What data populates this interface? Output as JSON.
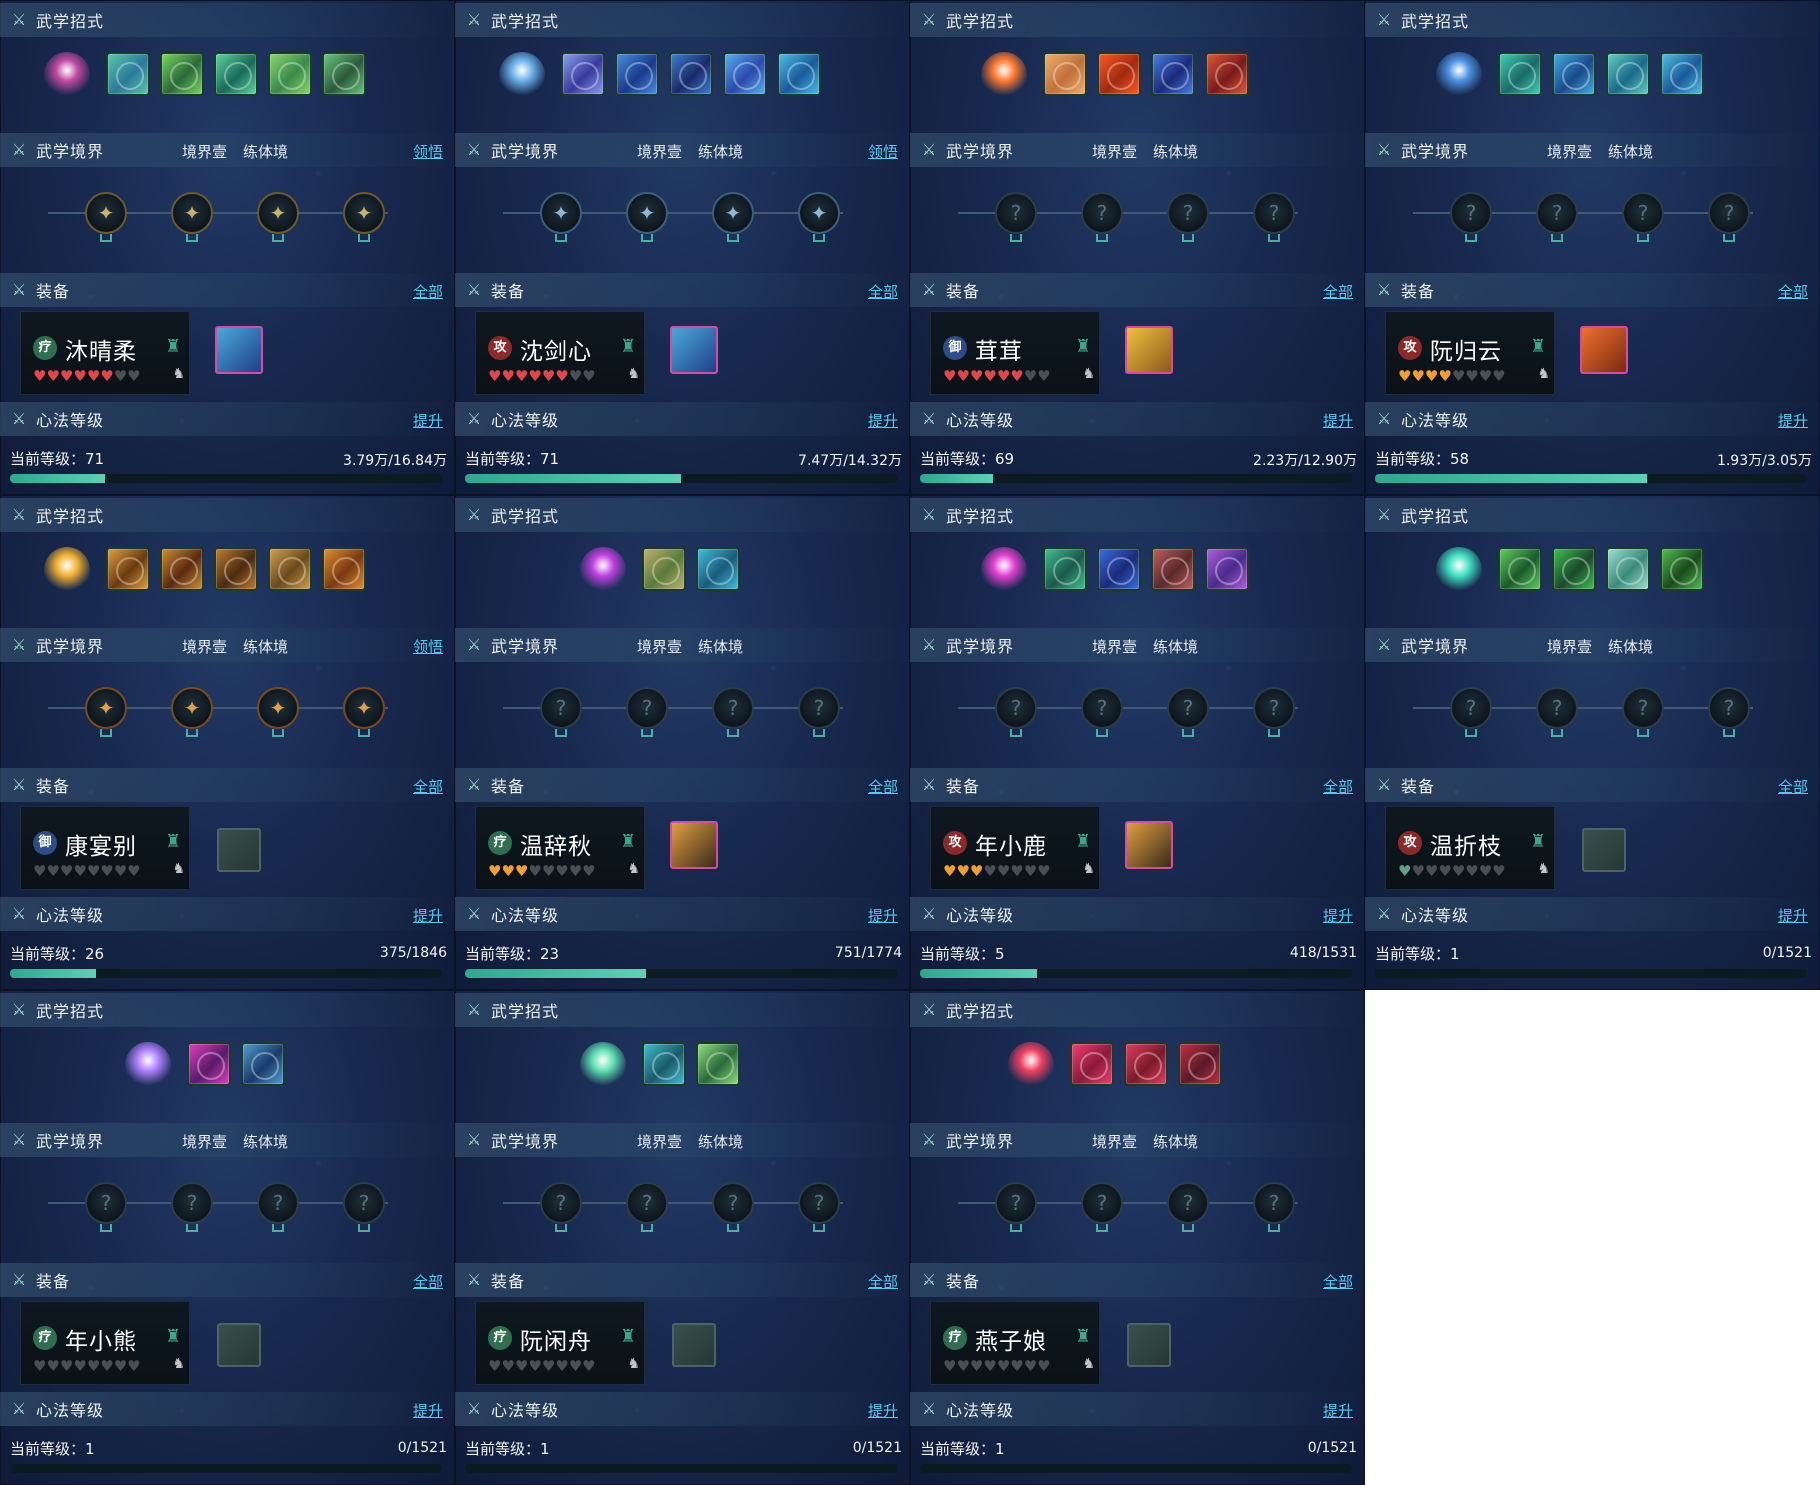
{
  "labels": {
    "skills": "武学招式",
    "realm": "武学境界",
    "realm_stage": "境界壹",
    "realm_type": "练体境",
    "comprehend": "领悟",
    "equip": "装备",
    "equip_all": "全部",
    "xinfa": "心法等级",
    "upgrade": "提升",
    "level_prefix": "当前等级："
  },
  "panels": [
    {
      "name": "沐晴柔",
      "role": "疗",
      "role_class": "heal",
      "hearts": "ffffffee",
      "level": "71",
      "exp": "3.79万/16.84万",
      "progress": 0.22,
      "realm_link": true,
      "nodes": "lit",
      "gear": "filled",
      "gear_colors": [
        "#4aa8d8",
        "#1f3f8a"
      ],
      "skill_colors": [
        [
          "#c04aa0",
          "#6a2a7a"
        ],
        [
          "#58c8a8",
          "#2a7a9a"
        ],
        [
          "#7ad860",
          "#2a6a3a"
        ],
        [
          "#5ad8a0",
          "#1a6a5a"
        ],
        [
          "#8ad870",
          "#3a8a4a"
        ],
        [
          "#6ac880",
          "#2a5a3a"
        ]
      ]
    },
    {
      "name": "沈剑心",
      "role": "攻",
      "role_class": "atk",
      "hearts": "ffffffee",
      "level": "71",
      "exp": "7.47万/14.32万",
      "progress": 0.5,
      "realm_link": true,
      "nodes": "lit-blue",
      "gear": "filled",
      "gear_colors": [
        "#4aa8d8",
        "#1f3f8a"
      ],
      "skill_colors": [
        [
          "#6ab0e8",
          "#2a4a9a"
        ],
        [
          "#8aa0f0",
          "#3a3a9a"
        ],
        [
          "#4a90e0",
          "#1a3a8a"
        ],
        [
          "#3a80d0",
          "#1a2a6a"
        ],
        [
          "#5ab0f0",
          "#2a4aaa"
        ],
        [
          "#4ac0e8",
          "#1a5a9a"
        ]
      ]
    },
    {
      "name": "茸茸",
      "role": "御",
      "role_class": "def",
      "hearts": "ffffffee",
      "level": "69",
      "exp": "2.23万/12.90万",
      "progress": 0.17,
      "realm_link": false,
      "nodes": "dark",
      "gear": "filled",
      "gear_colors": [
        "#f0c040",
        "#8a5a1a"
      ],
      "skill_colors": [
        [
          "#ff7a30",
          "#8a2a10"
        ],
        [
          "#f0b070",
          "#c0703a"
        ],
        [
          "#ff5a20",
          "#a02a10"
        ],
        [
          "#4a80e0",
          "#1a2a7a"
        ],
        [
          "#e05a3a",
          "#7a1a1a"
        ]
      ]
    },
    {
      "name": "阮归云",
      "role": "攻",
      "role_class": "atk",
      "hearts": "ggggeeee",
      "level": "58",
      "exp": "1.93万/3.05万",
      "progress": 0.63,
      "realm_link": false,
      "nodes": "dark",
      "gear": "filled",
      "gear_colors": [
        "#f07030",
        "#7a2a10"
      ],
      "skill_colors": [
        [
          "#4a90e0",
          "#1a3a8a"
        ],
        [
          "#40d0b0",
          "#1a6a6a"
        ],
        [
          "#40b0e0",
          "#1a4a8a"
        ],
        [
          "#60d0c0",
          "#1a6a8a"
        ],
        [
          "#50c0e0",
          "#1a5a9a"
        ]
      ]
    },
    {
      "name": "康宴别",
      "role": "御",
      "role_class": "def",
      "hearts": "eeeeeeee",
      "level": "26",
      "exp": "375/1846",
      "progress": 0.2,
      "realm_link": true,
      "nodes": "lit-orange",
      "gear": "empty",
      "gear_colors": [
        "#3a4f4c",
        "#273835"
      ],
      "skill_colors": [
        [
          "#f0b030",
          "#8a5a10"
        ],
        [
          "#e0a040",
          "#6a3a10"
        ],
        [
          "#d09030",
          "#5a2a10"
        ],
        [
          "#c08030",
          "#4a2a10"
        ],
        [
          "#d0a050",
          "#6a4a1a"
        ],
        [
          "#e09030",
          "#7a3a10"
        ]
      ]
    },
    {
      "name": "温辞秋",
      "role": "疗",
      "role_class": "heal",
      "hearts": "gggeeeee",
      "level": "23",
      "exp": "751/1774",
      "progress": 0.42,
      "realm_link": false,
      "nodes": "dark",
      "gear": "filled",
      "gear_colors": [
        "#e0a040",
        "#3a2a1a"
      ],
      "skill_colors": [
        [
          "#c040e0",
          "#4a1a6a"
        ],
        [
          "#c0b070",
          "#5a7a3a"
        ],
        [
          "#40c0e0",
          "#1a5a7a"
        ]
      ]
    },
    {
      "name": "年小鹿",
      "role": "攻",
      "role_class": "atk",
      "hearts": "gggeeeee",
      "level": "5",
      "exp": "418/1531",
      "progress": 0.27,
      "realm_link": false,
      "nodes": "dark",
      "gear": "filled",
      "gear_colors": [
        "#e0a040",
        "#3a2a1a"
      ],
      "skill_colors": [
        [
          "#e040d0",
          "#5a1a6a"
        ],
        [
          "#40c090",
          "#1a5a4a"
        ],
        [
          "#3a70e0",
          "#1a2a7a"
        ],
        [
          "#c06060",
          "#5a2a2a"
        ],
        [
          "#b060e0",
          "#4a2a8a"
        ]
      ]
    },
    {
      "name": "温折枝",
      "role": "攻",
      "role_class": "atk",
      "hearts": "heeeeeee",
      "level": "1",
      "exp": "0/1521",
      "progress": 0,
      "realm_link": false,
      "nodes": "dark",
      "gear": "empty",
      "gear_colors": [
        "#3a4f4c",
        "#273835"
      ],
      "skill_colors": [
        [
          "#40e0c0",
          "#1a5a6a"
        ],
        [
          "#60d060",
          "#1a5a2a"
        ],
        [
          "#40c050",
          "#1a4a2a"
        ],
        [
          "#a0e0d0",
          "#3a8a7a"
        ],
        [
          "#50c050",
          "#1a4a1a"
        ]
      ]
    },
    {
      "name": "年小熊",
      "role": "疗",
      "role_class": "heal",
      "hearts": "eeeeeeee",
      "level": "1",
      "exp": "0/1521",
      "progress": 0,
      "realm_link": false,
      "nodes": "dark",
      "gear": "empty",
      "gear_colors": [
        "#3a4f4c",
        "#273835"
      ],
      "skill_colors": [
        [
          "#b080ff",
          "#4a2a8a"
        ],
        [
          "#e040c0",
          "#5a1a6a"
        ],
        [
          "#50a0d0",
          "#1a3a6a"
        ]
      ]
    },
    {
      "name": "阮闲舟",
      "role": "疗",
      "role_class": "heal",
      "hearts": "eeeeeeee",
      "level": "1",
      "exp": "0/1521",
      "progress": 0,
      "realm_link": false,
      "nodes": "dark",
      "gear": "empty",
      "gear_colors": [
        "#3a4f4c",
        "#273835"
      ],
      "skill_colors": [
        [
          "#60e0b0",
          "#1a5a4a"
        ],
        [
          "#40c0d0",
          "#1a5a6a"
        ],
        [
          "#90e080",
          "#2a6a3a"
        ]
      ]
    },
    {
      "name": "燕子娘",
      "role": "疗",
      "role_class": "heal",
      "hearts": "eeeeeeee",
      "level": "1",
      "exp": "0/1521",
      "progress": 0,
      "realm_link": false,
      "nodes": "dark",
      "gear": "empty",
      "gear_colors": [
        "#3a4f4c",
        "#273835"
      ],
      "skill_colors": [
        [
          "#f04060",
          "#7a1a2a"
        ],
        [
          "#f04070",
          "#8a1a3a"
        ],
        [
          "#e04060",
          "#7a1a2a"
        ],
        [
          "#c03040",
          "#5a1a2a"
        ]
      ]
    }
  ]
}
